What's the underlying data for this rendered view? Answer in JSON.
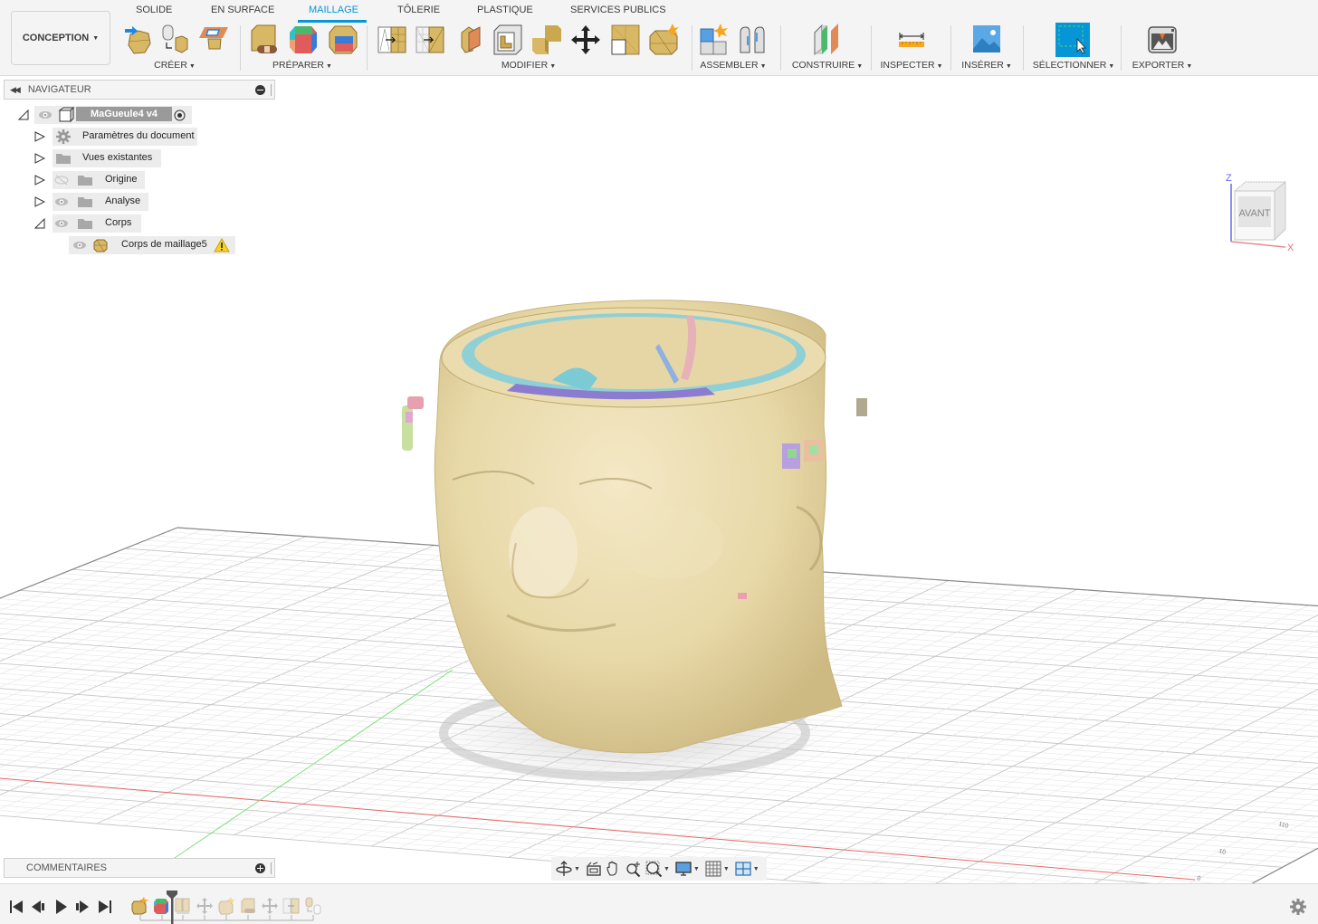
{
  "workspace": {
    "label": "CONCEPTION",
    "caret": "▼"
  },
  "tabs": [
    {
      "label": "SOLIDE",
      "active": false
    },
    {
      "label": "EN SURFACE",
      "active": false
    },
    {
      "label": "MAILLAGE",
      "active": true
    },
    {
      "label": "TÔLERIE",
      "active": false
    },
    {
      "label": "PLASTIQUE",
      "active": false
    },
    {
      "label": "SERVICES PUBLICS",
      "active": false
    }
  ],
  "groups": [
    {
      "label": "CRÉER",
      "tools": [
        "insert-mesh-icon",
        "tessellate-icon",
        "create-face-group-icon"
      ]
    },
    {
      "label": "PRÉPARER",
      "tools": [
        "repair-icon",
        "generate-face-groups-icon",
        "combine-face-groups-icon"
      ]
    },
    {
      "label": "MODIFIER",
      "tools": [
        "remesh-icon",
        "reduce-icon",
        "erase-and-fill-icon",
        "shell-icon",
        "combine-icon",
        "move-icon",
        "plane-cut-icon",
        "separate-icon"
      ]
    },
    {
      "label": "ASSEMBLER",
      "tools": [
        "new-component-icon",
        "joint-icon"
      ]
    },
    {
      "label": "CONSTRUIRE",
      "tools": [
        "offset-plane-icon"
      ]
    },
    {
      "label": "INSPECTER",
      "tools": [
        "measure-icon"
      ]
    },
    {
      "label": "INSÉRER",
      "tools": [
        "insert-image-icon"
      ]
    },
    {
      "label": "SÉLECTIONNER",
      "tools": [
        "select-icon"
      ]
    },
    {
      "label": "EXPORTER",
      "tools": [
        "export-icon"
      ]
    }
  ],
  "colors": {
    "accent": "#0696d7",
    "mesh": "#e8d9a8",
    "axis_x": "#e26a6a",
    "axis_y": "#7de07d",
    "axis_z": "#5b5bea"
  },
  "navigator": {
    "title": "NAVIGATEUR",
    "root": {
      "label": "MaGueule4 v4"
    },
    "items": [
      {
        "label": "Paramètres du document",
        "icon": "gear-icon",
        "visible": null,
        "expanded": false
      },
      {
        "label": "Vues existantes",
        "icon": "folder-icon",
        "visible": null,
        "expanded": false
      },
      {
        "label": "Origine",
        "icon": "folder-icon",
        "visible": false,
        "expanded": false
      },
      {
        "label": "Analyse",
        "icon": "folder-icon",
        "visible": true,
        "expanded": false
      },
      {
        "label": "Corps",
        "icon": "folder-icon",
        "visible": true,
        "expanded": true
      }
    ],
    "child": {
      "label": "Corps de maillage5",
      "icon": "mesh-body-icon",
      "warning": true
    }
  },
  "viewcube": {
    "face": "AVANT",
    "axis_z": "Z",
    "axis_x": "X"
  },
  "grid_labels": [
    "0",
    "10",
    "110"
  ],
  "comments": {
    "title": "COMMENTAIRES"
  },
  "navbar": [
    "orbit-icon",
    "look-at-icon",
    "pan-icon",
    "zoom-icon",
    "fit-icon",
    "display-settings-icon",
    "grid-settings-icon",
    "viewports-icon"
  ],
  "timeline": {
    "controls": [
      "first-icon",
      "previous-icon",
      "play-icon",
      "next-icon",
      "last-icon"
    ],
    "features": [
      "insert-mesh-feature",
      "face-groups-feature",
      "remesh-feature",
      "move-feature",
      "separate-feature",
      "repair-feature",
      "move-feature",
      "reduce-feature",
      "tessellate-feature"
    ],
    "marker_after": 2
  }
}
